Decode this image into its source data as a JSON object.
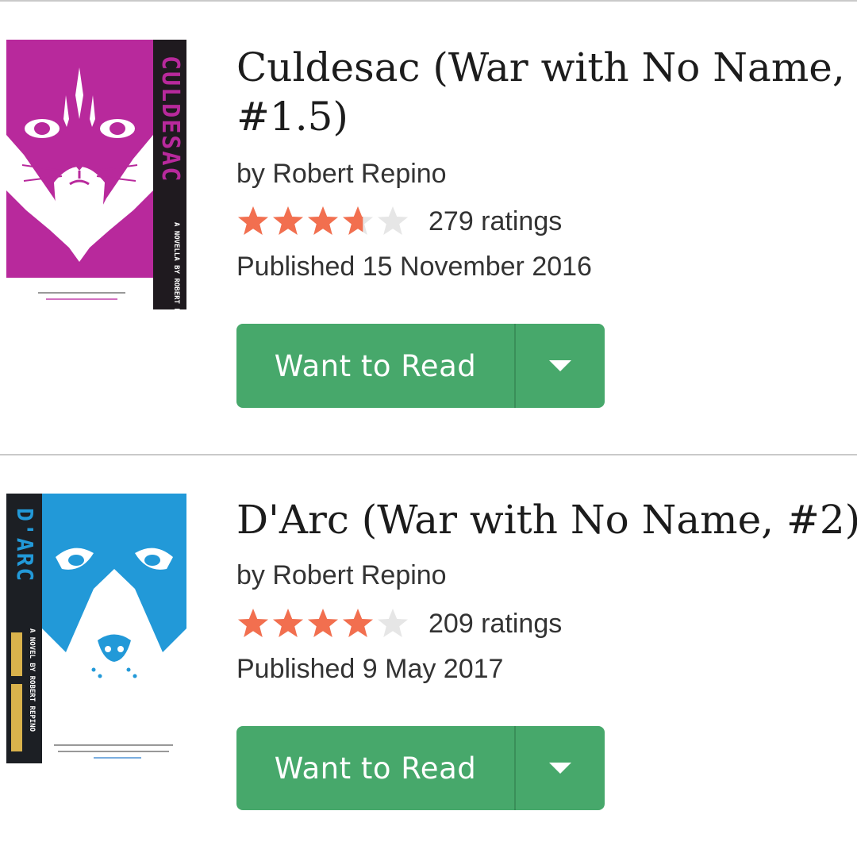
{
  "books": [
    {
      "title": "Culdesac (War with No Name,\n#1.5)",
      "author": "by Robert Repino",
      "rating_fraction": 0.73,
      "ratings": "279 ratings",
      "published": "Published 15 November 2016",
      "button_label": "Want to Read",
      "cover": {
        "spine_title": "CULDESAC",
        "spine_sub": "A NOVELLA BY ROBERT REPINO",
        "background": "#b8299c",
        "spine_color": "#1f1a1f"
      }
    },
    {
      "title": "D'Arc (War with No Name, #2)",
      "author": "by Robert Repino",
      "rating_fraction": 0.8,
      "ratings": "209 ratings",
      "published": "Published 9 May 2017",
      "button_label": "Want to Read",
      "cover": {
        "spine_title": "D'ARC",
        "spine_sub": "A NOVEL BY ROBERT REPINO",
        "background": "#2299d8",
        "spine_color": "#1c1f24"
      }
    }
  ],
  "colors": {
    "star_filled": "#f26f4f",
    "star_empty": "#e6e6e6",
    "button": "#47a86b"
  },
  "icons": {
    "star": "star-icon",
    "dropdown": "caret-down-icon"
  }
}
